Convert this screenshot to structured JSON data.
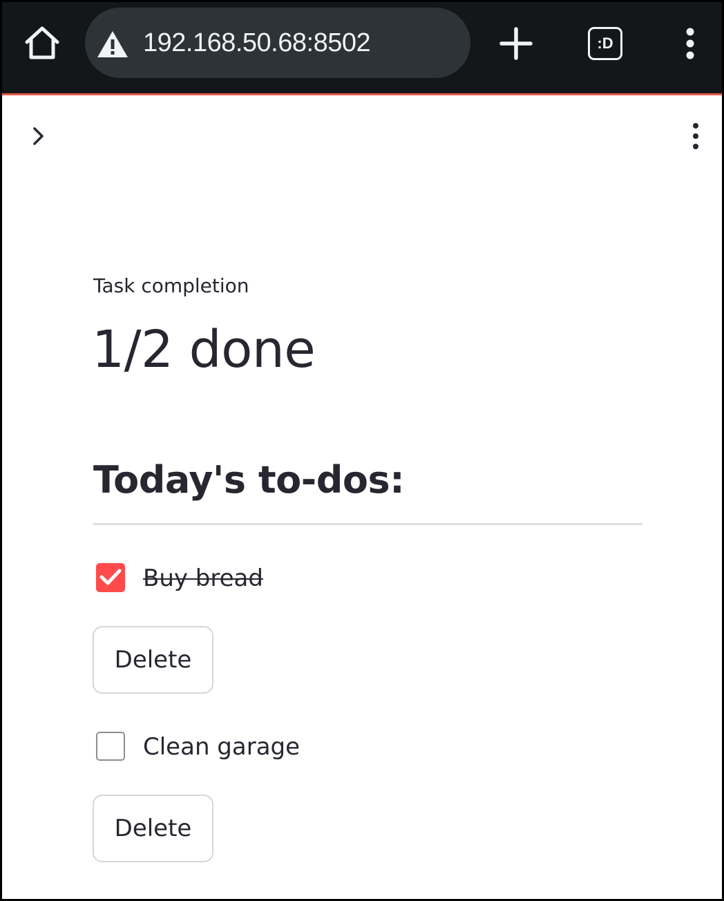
{
  "browser": {
    "url": "192.168.50.68:8502",
    "tab_switcher_label": ":D",
    "icons": {
      "home": "home-icon",
      "security": "warning-icon",
      "new_tab": "plus-icon",
      "tabs": "tab-switcher-icon",
      "menu": "more-vert-icon"
    },
    "colors": {
      "toolbar": "#141719",
      "url_bar": "#2d3336",
      "accent_line": "#e65a4a"
    }
  },
  "app": {
    "header": {
      "sidebar_toggle_icon": "chevron-right-icon",
      "menu_icon": "more-vert-icon"
    },
    "metric": {
      "label": "Task completion",
      "value": "1/2 done"
    },
    "subheader": "Today's to-dos:",
    "todos": [
      {
        "label": "Buy bread",
        "checked": true,
        "delete_label": "Delete"
      },
      {
        "label": "Clean garage",
        "checked": false,
        "delete_label": "Delete"
      }
    ],
    "colors": {
      "primary": "#ff4b4b",
      "text": "#262730",
      "divider": "#dcdde1"
    }
  }
}
